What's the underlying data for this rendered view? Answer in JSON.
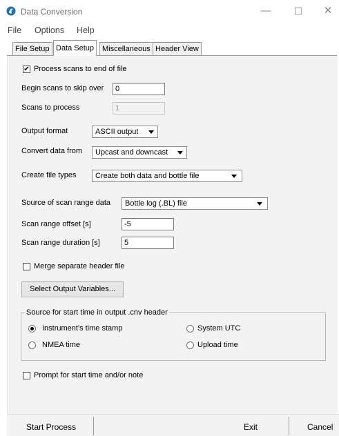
{
  "window": {
    "title": "Data Conversion",
    "minimize": "—",
    "maximize": "☐",
    "close": "✕"
  },
  "menu": [
    "File",
    "Options",
    "Help"
  ],
  "tabs": [
    {
      "label": "File Setup",
      "active": false
    },
    {
      "label": "Data Setup",
      "active": true
    },
    {
      "label": "Miscellaneous",
      "active": false
    },
    {
      "label": "Header View",
      "active": false
    }
  ],
  "data_setup": {
    "process_to_eof": {
      "label": "Process scans to end of file",
      "checked": true
    },
    "begin_skip": {
      "label": "Begin scans to skip over",
      "value": "0"
    },
    "scans_to_process": {
      "label": "Scans to process",
      "value": "1"
    },
    "output_format": {
      "label": "Output format",
      "value": "ASCII output"
    },
    "convert_from": {
      "label": "Convert data from",
      "value": "Upcast and downcast"
    },
    "file_types": {
      "label": "Create file types",
      "value": "Create both data and bottle file"
    },
    "scan_range_source": {
      "label": "Source of scan range data",
      "value": "Bottle log (.BL) file"
    },
    "scan_range_offset": {
      "label": "Scan range offset [s]",
      "value": "-5"
    },
    "scan_range_duration": {
      "label": "Scan range duration [s]",
      "value": "5"
    },
    "merge_header": {
      "label": "Merge separate header file",
      "checked": false
    },
    "select_output_button": "Select Output Variables...",
    "start_time_group": {
      "title": "Source for start time in output .cnv header",
      "options": [
        {
          "label": "Instrument's time stamp",
          "selected": true
        },
        {
          "label": "System UTC",
          "selected": false
        },
        {
          "label": "NMEA time",
          "selected": false
        },
        {
          "label": "Upload time",
          "selected": false
        }
      ]
    },
    "prompt_start_time": {
      "label": "Prompt for start time and/or note",
      "checked": false
    }
  },
  "footer": {
    "start": "Start Process",
    "exit": "Exit",
    "cancel": "Cancel"
  },
  "colors": {
    "icon_blue": "#1f6fbf",
    "panel_bg": "#f3f3f3"
  }
}
